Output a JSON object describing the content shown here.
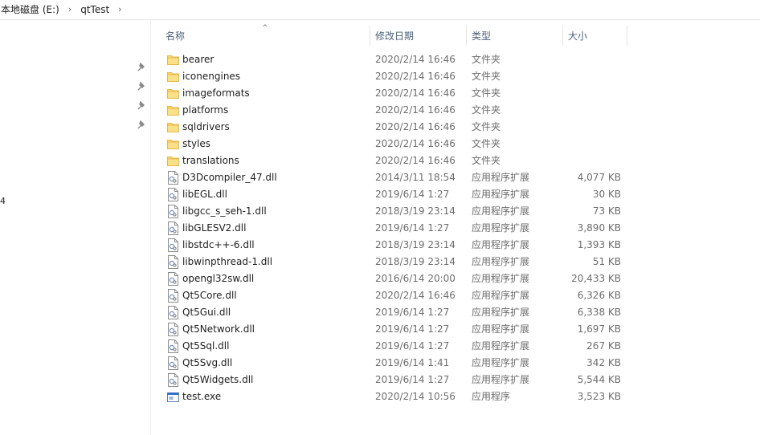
{
  "breadcrumb": {
    "drive": "本地磁盘 (E:)",
    "folder": "qtTest",
    "separator": "›"
  },
  "nav": {
    "stray_char": "4"
  },
  "columns": {
    "name": "名称",
    "date": "修改日期",
    "type": "类型",
    "size": "大小",
    "sort_icon": "^"
  },
  "files": [
    {
      "name": "bearer",
      "date": "2020/2/14 16:46",
      "type": "文件夹",
      "size": "",
      "icon": "folder-icon"
    },
    {
      "name": "iconengines",
      "date": "2020/2/14 16:46",
      "type": "文件夹",
      "size": "",
      "icon": "folder-icon"
    },
    {
      "name": "imageformats",
      "date": "2020/2/14 16:46",
      "type": "文件夹",
      "size": "",
      "icon": "folder-icon"
    },
    {
      "name": "platforms",
      "date": "2020/2/14 16:46",
      "type": "文件夹",
      "size": "",
      "icon": "folder-icon"
    },
    {
      "name": "sqldrivers",
      "date": "2020/2/14 16:46",
      "type": "文件夹",
      "size": "",
      "icon": "folder-icon"
    },
    {
      "name": "styles",
      "date": "2020/2/14 16:46",
      "type": "文件夹",
      "size": "",
      "icon": "folder-icon"
    },
    {
      "name": "translations",
      "date": "2020/2/14 16:46",
      "type": "文件夹",
      "size": "",
      "icon": "folder-icon"
    },
    {
      "name": "D3Dcompiler_47.dll",
      "date": "2014/3/11 18:54",
      "type": "应用程序扩展",
      "size": "4,077 KB",
      "icon": "dll-file-icon"
    },
    {
      "name": "libEGL.dll",
      "date": "2019/6/14 1:27",
      "type": "应用程序扩展",
      "size": "30 KB",
      "icon": "dll-file-icon"
    },
    {
      "name": "libgcc_s_seh-1.dll",
      "date": "2018/3/19 23:14",
      "type": "应用程序扩展",
      "size": "73 KB",
      "icon": "dll-file-icon"
    },
    {
      "name": "libGLESV2.dll",
      "date": "2019/6/14 1:27",
      "type": "应用程序扩展",
      "size": "3,890 KB",
      "icon": "dll-file-icon"
    },
    {
      "name": "libstdc++-6.dll",
      "date": "2018/3/19 23:14",
      "type": "应用程序扩展",
      "size": "1,393 KB",
      "icon": "dll-file-icon"
    },
    {
      "name": "libwinpthread-1.dll",
      "date": "2018/3/19 23:14",
      "type": "应用程序扩展",
      "size": "51 KB",
      "icon": "dll-file-icon"
    },
    {
      "name": "opengl32sw.dll",
      "date": "2016/6/14 20:00",
      "type": "应用程序扩展",
      "size": "20,433 KB",
      "icon": "dll-file-icon"
    },
    {
      "name": "Qt5Core.dll",
      "date": "2020/2/14 16:46",
      "type": "应用程序扩展",
      "size": "6,326 KB",
      "icon": "dll-file-icon"
    },
    {
      "name": "Qt5Gui.dll",
      "date": "2019/6/14 1:27",
      "type": "应用程序扩展",
      "size": "6,338 KB",
      "icon": "dll-file-icon"
    },
    {
      "name": "Qt5Network.dll",
      "date": "2019/6/14 1:27",
      "type": "应用程序扩展",
      "size": "1,697 KB",
      "icon": "dll-file-icon"
    },
    {
      "name": "Qt5Sql.dll",
      "date": "2019/6/14 1:27",
      "type": "应用程序扩展",
      "size": "267 KB",
      "icon": "dll-file-icon"
    },
    {
      "name": "Qt5Svg.dll",
      "date": "2019/6/14 1:41",
      "type": "应用程序扩展",
      "size": "342 KB",
      "icon": "dll-file-icon"
    },
    {
      "name": "Qt5Widgets.dll",
      "date": "2019/6/14 1:27",
      "type": "应用程序扩展",
      "size": "5,544 KB",
      "icon": "dll-file-icon"
    },
    {
      "name": "test.exe",
      "date": "2020/2/14 10:56",
      "type": "应用程序",
      "size": "3,523 KB",
      "icon": "exe-file-icon"
    }
  ],
  "colors": {
    "header_text": "#4c607a",
    "folder": "#f8d775",
    "folder_dark": "#e8b94a",
    "meta_text": "#6d6d6d"
  }
}
